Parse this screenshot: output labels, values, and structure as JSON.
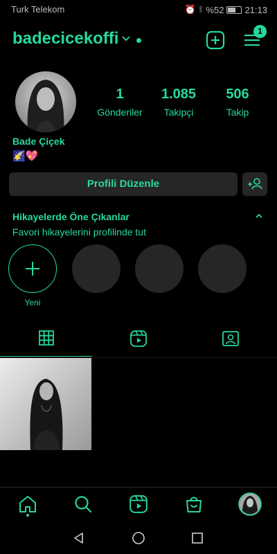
{
  "status_bar": {
    "carrier": "Turk Telekom",
    "battery_text": "%52",
    "time": "21:13",
    "battery_level": 0.52
  },
  "header": {
    "username": "badecicekoffi",
    "notification_count": "1"
  },
  "profile": {
    "stats": [
      {
        "value": "1",
        "label": "Gönderiler"
      },
      {
        "value": "1.085",
        "label": "Takipçi"
      },
      {
        "value": "506",
        "label": "Takip"
      }
    ],
    "full_name": "Bade Çiçek",
    "bio": "🌠💖",
    "edit_profile_label": "Profili Düzenle"
  },
  "highlights": {
    "title": "Hikayelerde Öne Çıkanlar",
    "subtitle": "Favori hikayelerini profilinde tut",
    "new_label": "Yeni"
  },
  "colors": {
    "accent": "#26d9a1",
    "background": "#000000",
    "surface": "#262626"
  },
  "icons": {
    "tabs": [
      "grid-icon",
      "reels-icon",
      "tagged-icon"
    ],
    "bottom_nav": [
      "home-icon",
      "search-icon",
      "reels-icon",
      "shop-icon",
      "profile-avatar"
    ]
  }
}
